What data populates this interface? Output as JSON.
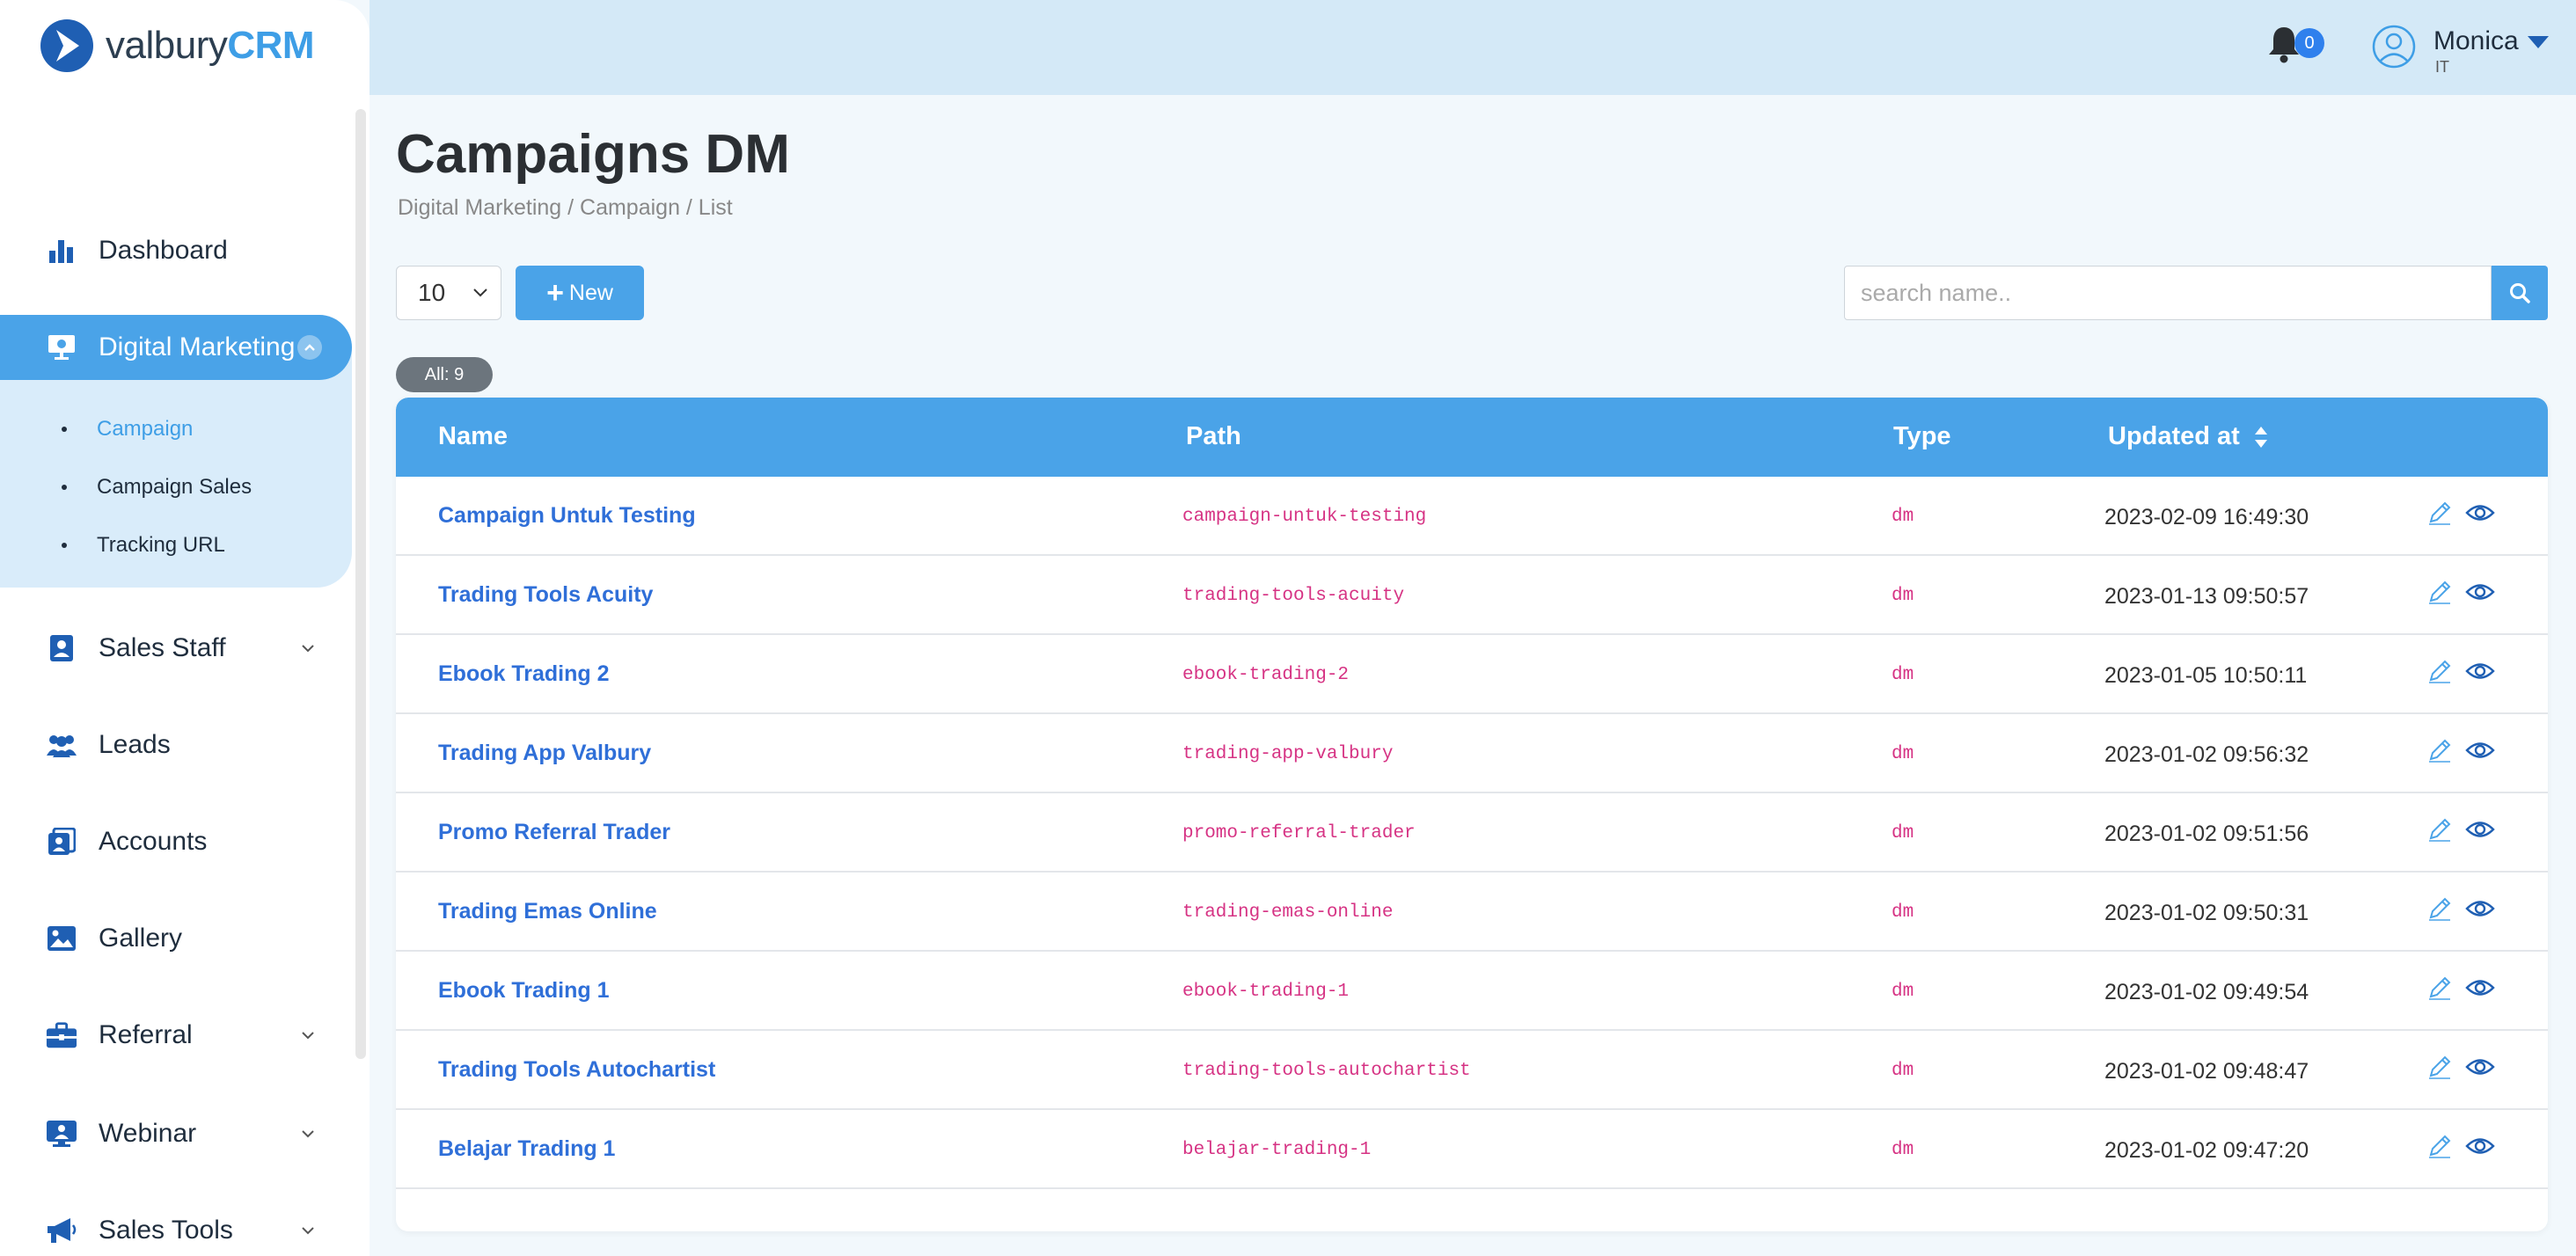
{
  "app": {
    "logo_prefix": "valbury",
    "logo_suffix": "CRM"
  },
  "sidebar": {
    "items": [
      {
        "label": "Dashboard",
        "icon": "bar-chart-icon"
      },
      {
        "label": "Digital Marketing",
        "icon": "presentation-icon",
        "active": true
      },
      {
        "label": "Sales Staff",
        "icon": "id-badge-icon"
      },
      {
        "label": "Leads",
        "icon": "users-icon"
      },
      {
        "label": "Accounts",
        "icon": "contacts-icon"
      },
      {
        "label": "Gallery",
        "icon": "image-icon"
      },
      {
        "label": "Referral",
        "icon": "briefcase-icon"
      },
      {
        "label": "Webinar",
        "icon": "webinar-icon"
      },
      {
        "label": "Sales Tools",
        "icon": "megaphone-icon"
      }
    ],
    "submenu": [
      {
        "label": "Campaign",
        "active": true
      },
      {
        "label": "Campaign Sales"
      },
      {
        "label": "Tracking URL"
      }
    ]
  },
  "topbar": {
    "notification_count": "0",
    "user_name": "Monica",
    "user_role": "IT"
  },
  "page": {
    "title": "Campaigns DM",
    "breadcrumb": "Digital Marketing / Campaign / List"
  },
  "toolbar": {
    "per_page": "10",
    "new_label": "New",
    "search_placeholder": "search name.."
  },
  "count_badge": "All: 9",
  "table": {
    "headers": {
      "name": "Name",
      "path": "Path",
      "type": "Type",
      "updated": "Updated at"
    },
    "rows": [
      {
        "name": "Campaign Untuk Testing",
        "path": "campaign-untuk-testing",
        "type": "dm",
        "updated": "2023-02-09 16:49:30"
      },
      {
        "name": "Trading Tools Acuity",
        "path": "trading-tools-acuity",
        "type": "dm",
        "updated": "2023-01-13 09:50:57"
      },
      {
        "name": "Ebook Trading 2",
        "path": "ebook-trading-2",
        "type": "dm",
        "updated": "2023-01-05 10:50:11"
      },
      {
        "name": "Trading App Valbury",
        "path": "trading-app-valbury",
        "type": "dm",
        "updated": "2023-01-02 09:56:32"
      },
      {
        "name": "Promo Referral Trader",
        "path": "promo-referral-trader",
        "type": "dm",
        "updated": "2023-01-02 09:51:56"
      },
      {
        "name": "Trading Emas Online",
        "path": "trading-emas-online",
        "type": "dm",
        "updated": "2023-01-02 09:50:31"
      },
      {
        "name": "Ebook Trading 1",
        "path": "ebook-trading-1",
        "type": "dm",
        "updated": "2023-01-02 09:49:54"
      },
      {
        "name": "Trading Tools Autochartist",
        "path": "trading-tools-autochartist",
        "type": "dm",
        "updated": "2023-01-02 09:48:47"
      },
      {
        "name": "Belajar Trading 1",
        "path": "belajar-trading-1",
        "type": "dm",
        "updated": "2023-01-02 09:47:20"
      }
    ]
  },
  "colors": {
    "primary": "#4aa3e8",
    "link": "#2f6fd8",
    "code": "#d63384",
    "sidebar_active_bg": "#d9ecfa",
    "topbar_bg": "#d4e9f7"
  }
}
